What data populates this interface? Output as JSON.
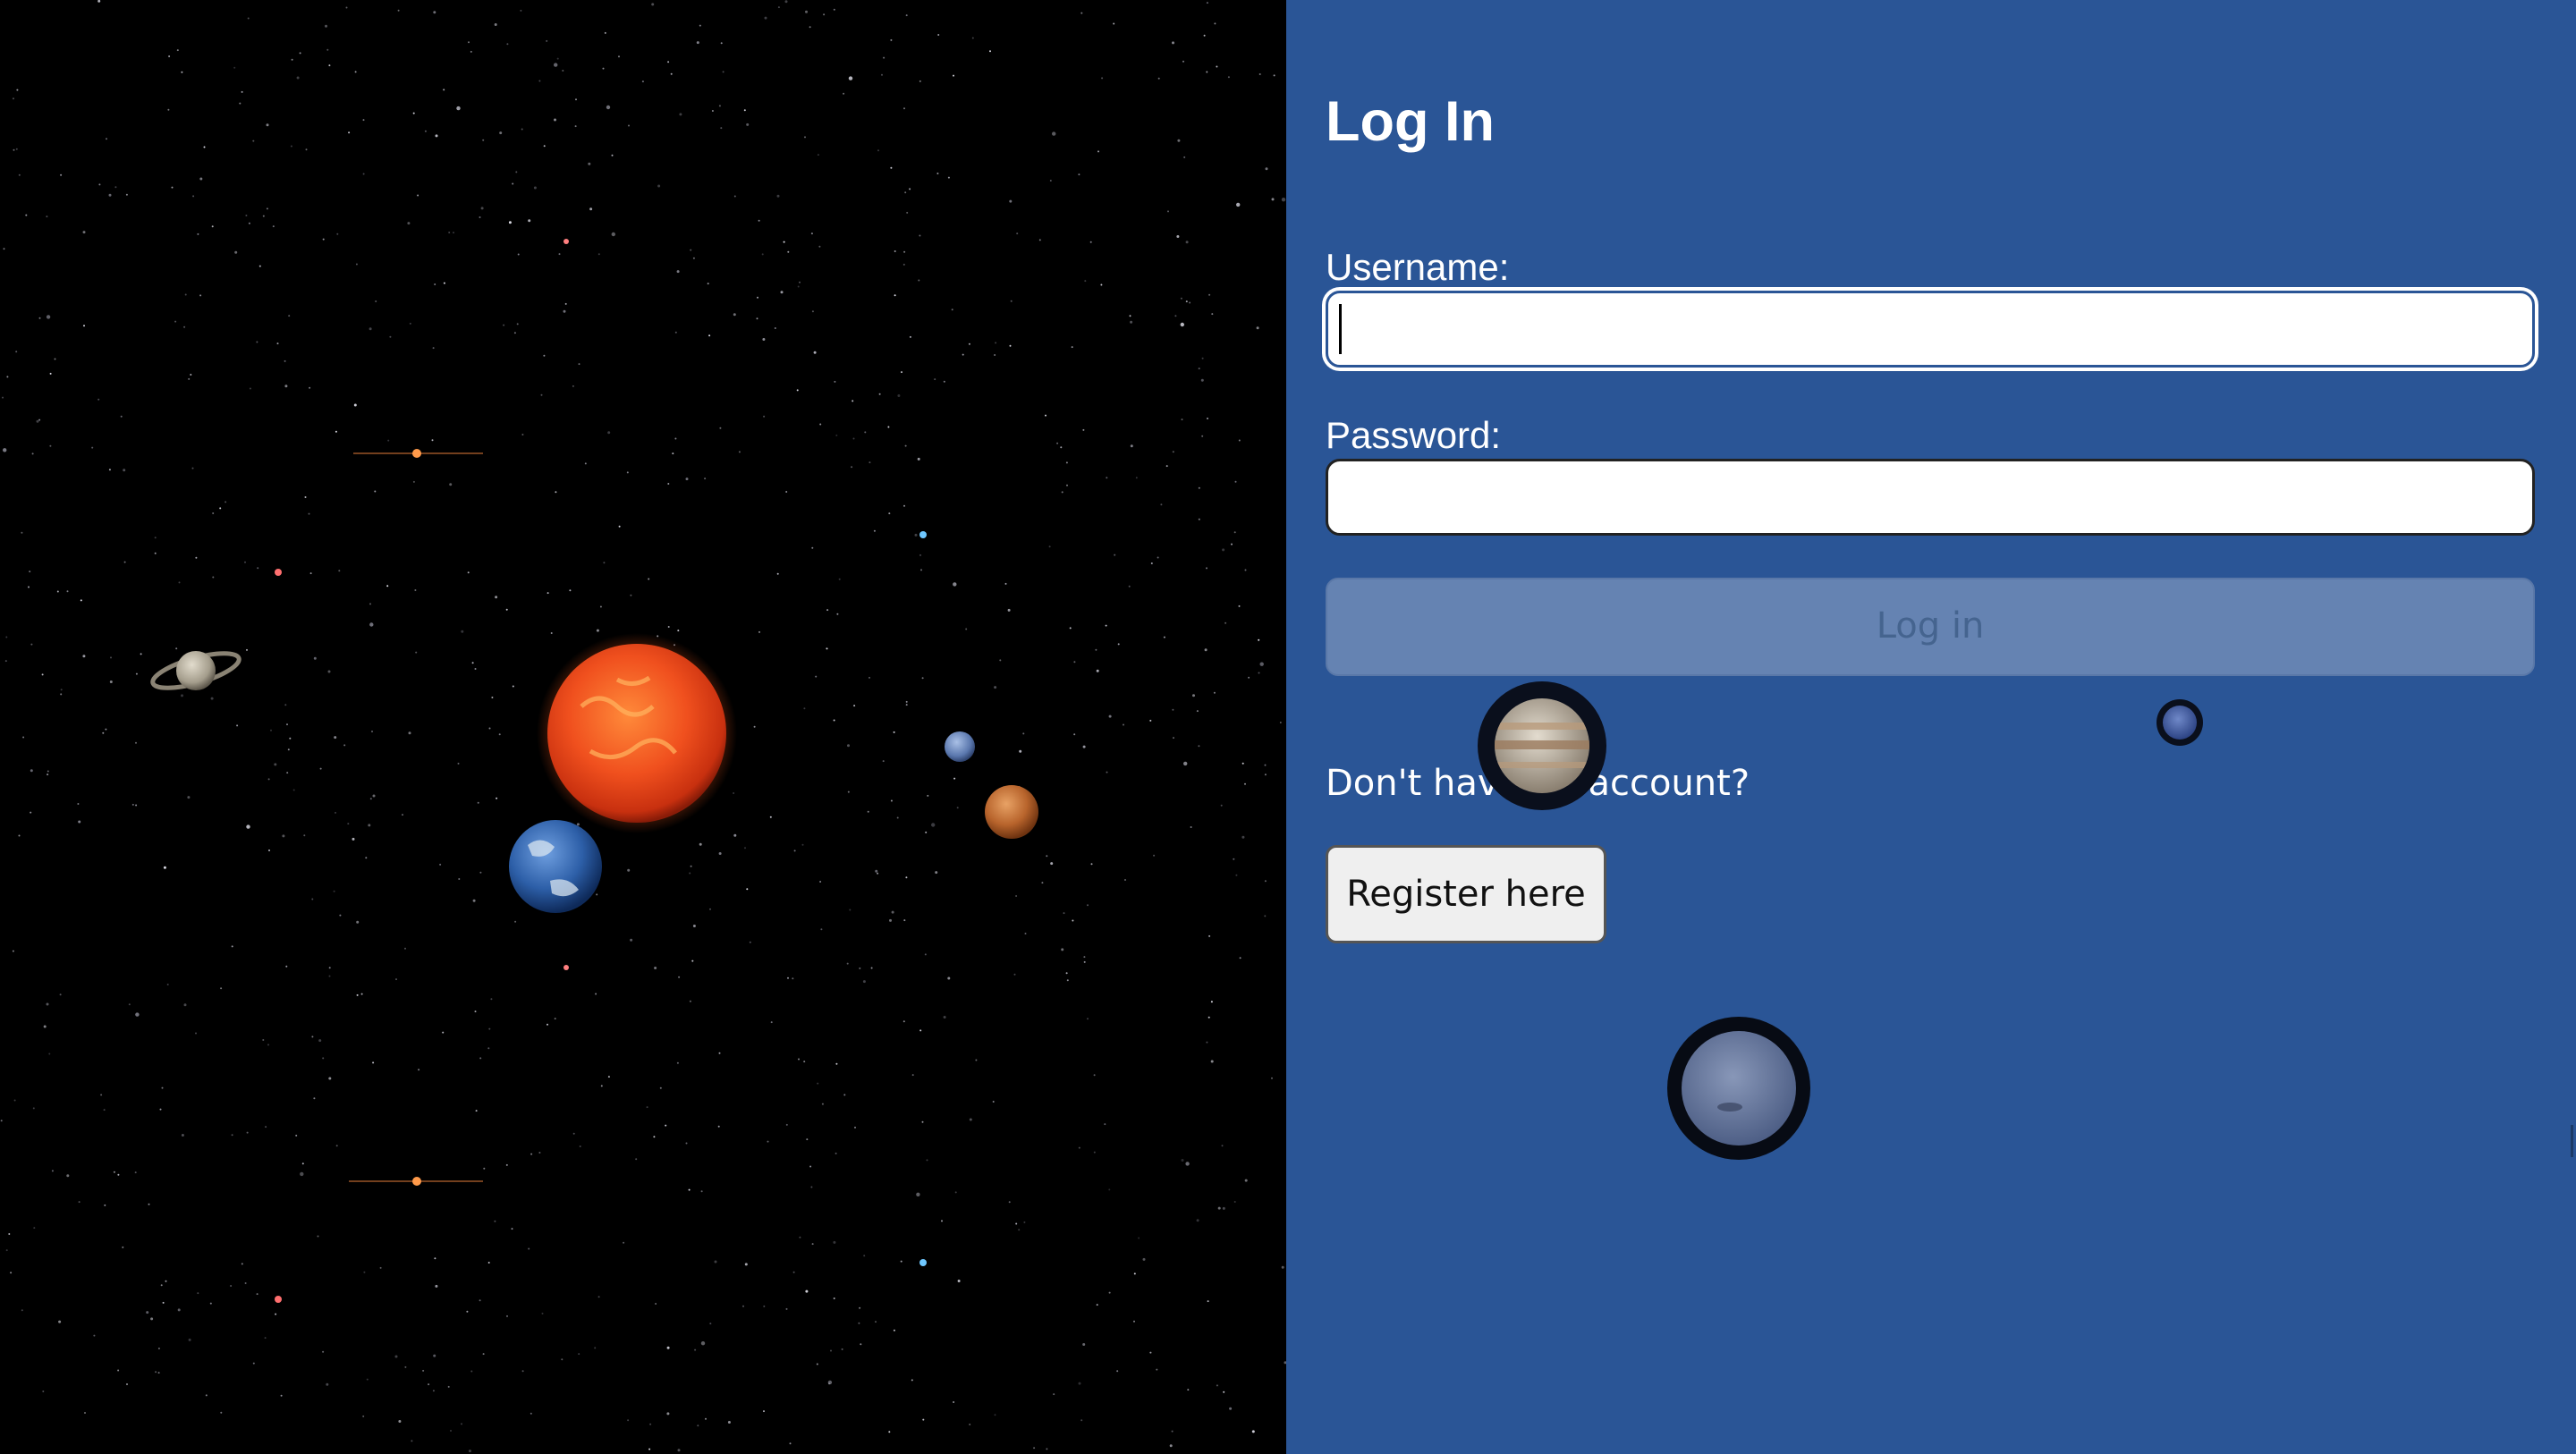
{
  "login_panel": {
    "title": "Log In",
    "username_label": "Username:",
    "username_value": "",
    "password_label": "Password:",
    "password_value": "",
    "login_button": "Log in",
    "register_prompt": "Don't have an account?",
    "register_button": "Register here"
  },
  "colors": {
    "panel_background": "#2a5596",
    "space_background": "#000000",
    "login_button_disabled": "#6583b2",
    "register_button_background": "#efefef"
  },
  "solar_system": {
    "bodies": [
      "sun-icon",
      "earth-icon",
      "saturn-icon",
      "mercury-icon",
      "venus-icon",
      "jupiter-icon",
      "neptune-icon",
      "uranus-icon"
    ]
  }
}
